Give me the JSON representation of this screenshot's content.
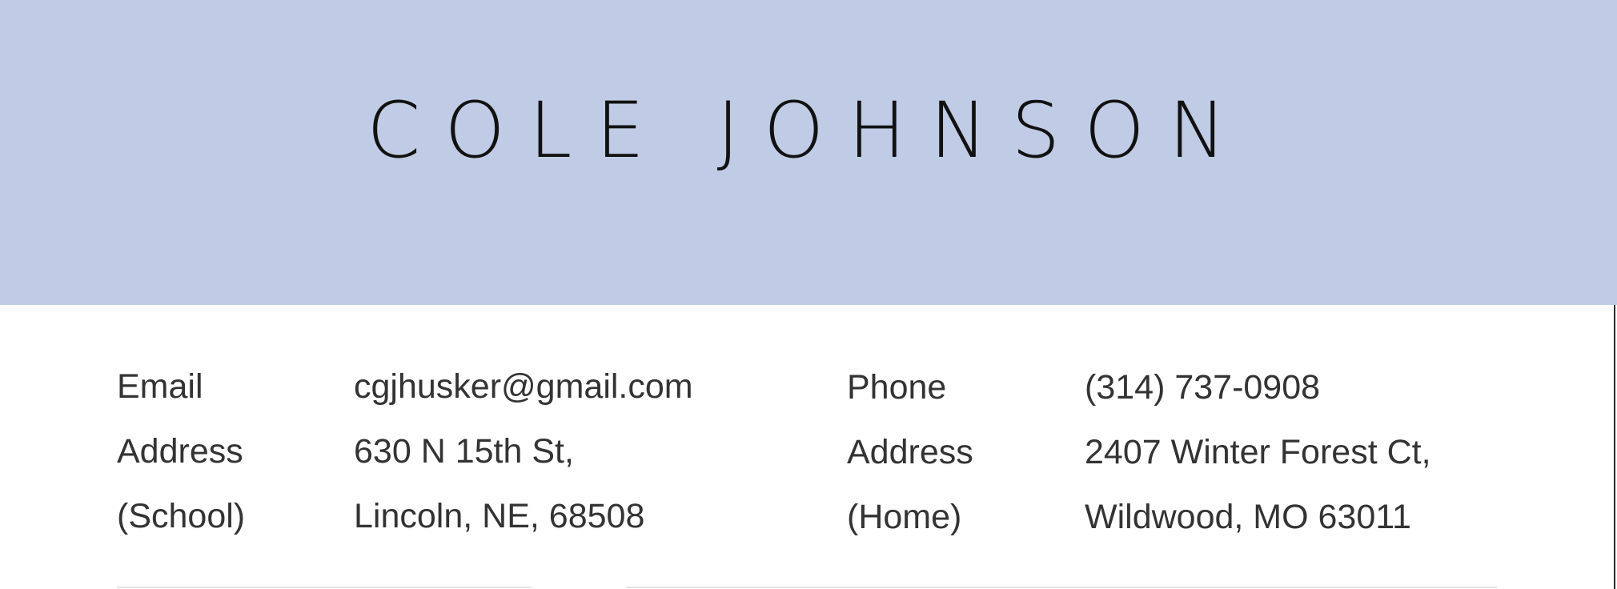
{
  "header": {
    "name": "COLE JOHNSON",
    "band_color": "#c0cce5"
  },
  "contact": {
    "email_label": "Email",
    "email_value": "cgjhusker@gmail.com",
    "school_address_label_line1": "Address",
    "school_address_label_line2": "(School)",
    "school_address_line1": "630 N 15th St,",
    "school_address_line2": "Lincoln, NE, 68508",
    "phone_label": "Phone",
    "phone_value": "(314) 737-0908",
    "home_address_label_line1": "Address",
    "home_address_label_line2": "(Home)",
    "home_address_line1": "2407 Winter Forest Ct,",
    "home_address_line2": "Wildwood, MO 63011"
  }
}
